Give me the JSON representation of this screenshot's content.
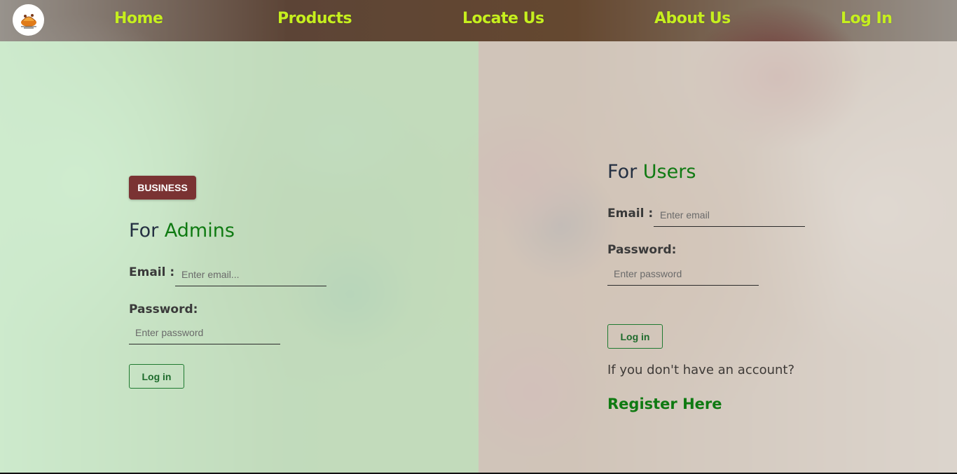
{
  "nav": {
    "logo_icon": "bakery-logo-icon",
    "links": [
      {
        "label": "Home"
      },
      {
        "label": "Products"
      },
      {
        "label": "Locate Us"
      },
      {
        "label": "About Us"
      },
      {
        "label": "Log In"
      }
    ],
    "link_color": "#c6ef1e"
  },
  "admin": {
    "badge": "BUSINESS",
    "heading_prefix": "For",
    "heading_accent": "Admins",
    "email_label": "Email :",
    "email_placeholder": "Enter email...",
    "password_label": "Password:",
    "password_placeholder": "Enter password",
    "login_button": "Log in"
  },
  "user": {
    "heading_prefix": "For",
    "heading_accent": "Users",
    "email_label": "Email :",
    "email_placeholder": "Enter email",
    "password_label": "Password:",
    "password_placeholder": "Enter password",
    "login_button": "Log in",
    "no_account_text": "If you don't have an account?",
    "register_link": "Register Here"
  },
  "colors": {
    "accent_green": "#0f7a12",
    "badge_bg": "#7a3333",
    "heading_dark": "#243042"
  }
}
